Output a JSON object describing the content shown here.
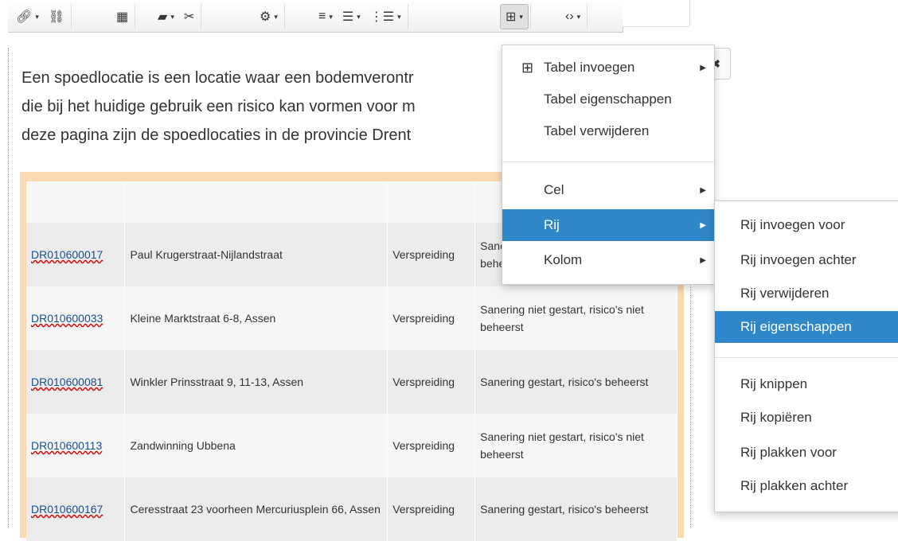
{
  "toolbar": {
    "groups": [
      [
        {
          "icon": "link-icon",
          "glyph": "🔗︎",
          "caret": true
        },
        {
          "icon": "unlink-icon",
          "glyph": "⛓",
          "caret": false
        }
      ],
      [
        {
          "icon": "widget-icon",
          "glyph": "▦",
          "caret": false
        }
      ],
      [
        {
          "icon": "image-icon",
          "glyph": "▰",
          "caret": true
        },
        {
          "icon": "cut-icon",
          "glyph": "✂",
          "caret": false
        }
      ],
      [
        {
          "icon": "gear-icon",
          "glyph": "⚙",
          "caret": true
        }
      ],
      [
        {
          "icon": "align-icon",
          "glyph": "≡",
          "caret": true
        },
        {
          "icon": "bullet-list-icon",
          "glyph": "☰",
          "caret": true
        },
        {
          "icon": "numbered-list-icon",
          "glyph": "⋮☰",
          "caret": true
        }
      ],
      [
        {
          "icon": "table-icon",
          "glyph": "⊞",
          "caret": true
        }
      ],
      [
        {
          "icon": "code-icon",
          "glyph": "‹›",
          "caret": true
        }
      ]
    ],
    "caret_glyph": "▾"
  },
  "paragraph": [
    "Een spoedlocatie is een locatie waar een bodemverontr",
    "die bij het huidige gebruik een risico kan vormen voor m",
    "deze pagina zijn de spoedlocaties in de provincie Drent"
  ],
  "table": {
    "rows": [
      {
        "code": "DR010600017",
        "location": "Paul Krugerstraat-Nijlandstraat",
        "type": "Verspreiding",
        "status": "Sanering niet gestart, risico's niet beheerst"
      },
      {
        "code": "DR010600033",
        "location": "Kleine Marktstraat 6-8, Assen",
        "type": "Verspreiding",
        "status": "Sanering niet gestart, risico's niet beheerst"
      },
      {
        "code": "DR010600081",
        "location": "Winkler Prinsstraat 9, 11-13, Assen",
        "type": "Verspreiding",
        "status": "Sanering gestart, risico's beheerst"
      },
      {
        "code": "DR010600113",
        "location": "Zandwinning Ubbena",
        "type": "Verspreiding",
        "status": "Sanering niet gestart, risico's niet beheerst"
      },
      {
        "code": "DR010600167",
        "location": "Ceresstraat 23 voorheen Mercuriusplein 66, Assen",
        "type": "Verspreiding",
        "status": "Sanering gestart, risico's beheerst"
      }
    ]
  },
  "table_menu": {
    "items": [
      {
        "label": "Tabel invoegen",
        "icon": "table-icon",
        "submenu": true
      },
      {
        "label": "Tabel eigenschappen",
        "submenu": false
      },
      {
        "label": "Tabel verwijderen",
        "submenu": false
      },
      {
        "label": "Cel",
        "submenu": true
      },
      {
        "label": "Rij",
        "submenu": true,
        "selected": true
      },
      {
        "label": "Kolom",
        "submenu": true
      }
    ],
    "arrow_glyph": "▶"
  },
  "row_menu": {
    "items": [
      {
        "label": "Rij invoegen voor"
      },
      {
        "label": "Rij invoegen achter"
      },
      {
        "label": "Rij verwijderen"
      },
      {
        "label": "Rij eigenschappen",
        "selected": true
      },
      {
        "label": "Rij knippen"
      },
      {
        "label": "Rij kopiëren"
      },
      {
        "label": "Rij plakken voor"
      },
      {
        "label": "Rij plakken achter"
      }
    ]
  },
  "colors": {
    "accent": "#2f86c8",
    "table_border": "#fbd9b3"
  }
}
